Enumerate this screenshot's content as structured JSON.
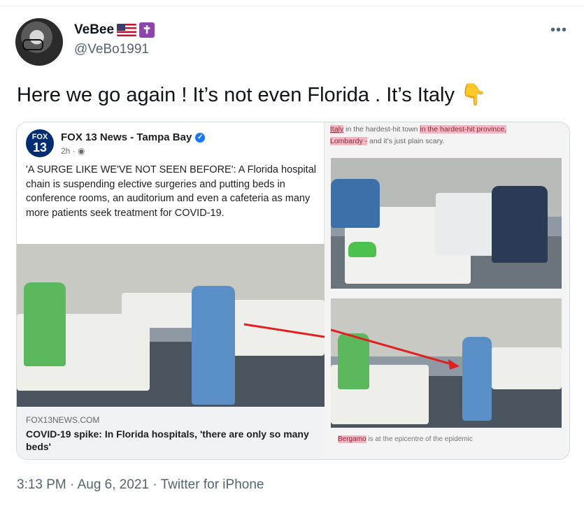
{
  "author": {
    "name": "VeBee",
    "handle": "@VeBo1991",
    "badge_cross": "✝"
  },
  "tweet": {
    "text": "Here we go again ! It’s not even Florida . It’s Italy",
    "emoji": "👇"
  },
  "menu": {
    "more_label": "•••"
  },
  "fox_post": {
    "logo_top": "FOX",
    "logo_num": "13",
    "page_name": "FOX 13 News - Tampa Bay",
    "verified_mark": "✓",
    "time": "2h · ◉",
    "body": "'A SURGE LIKE WE'VE NOT SEEN BEFORE': A Florida hospital chain is suspending elective surgeries and putting beds in conference rooms, an auditorium and even a cafeteria as many more patients seek treatment for COVID-19.",
    "link_domain": "FOX13NEWS.COM",
    "link_headline": "COVID-19 spike: In Florida hospitals, 'there are only so many beds'"
  },
  "italy_post": {
    "caption_italy": "Italy",
    "caption_mid": " in the hardest-hit town ",
    "caption_province": "in the hardest-hit province,",
    "caption_lombardy": "Lombardy -",
    "caption_end": " and it's just plain scary.",
    "bottom_bergamo": "Bergamo",
    "bottom_rest": " is at the epicentre of the epidemic"
  },
  "footer": {
    "meta": "3:13 PM · Aug 6, 2021 · Twitter for iPhone"
  },
  "colors": {
    "arrow": "#e02020",
    "verified": "#1877f2",
    "fox_blue": "#002d72",
    "highlight": "#f4b6c2"
  }
}
